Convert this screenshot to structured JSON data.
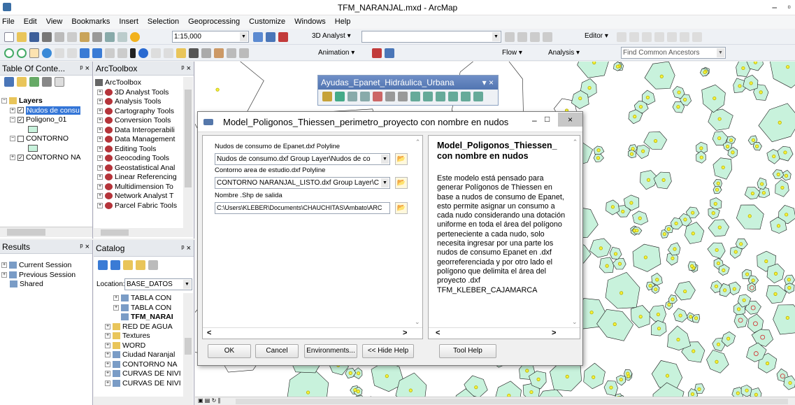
{
  "window": {
    "title": "TFM_NARANJAL.mxd - ArcMap",
    "minimize": "–",
    "restore": "▫"
  },
  "menu": [
    "File",
    "Edit",
    "View",
    "Bookmarks",
    "Insert",
    "Selection",
    "Geoprocessing",
    "Customize",
    "Windows",
    "Help"
  ],
  "toolbar": {
    "scale": "1:15,000",
    "analyst3d": "3D Analyst",
    "editor": "Editor",
    "animation": "Animation",
    "flow": "Flow",
    "analysis": "Analysis",
    "find_ancestors": "Find Common Ancestors"
  },
  "toc": {
    "title": "Table Of Conte...",
    "layers_label": "Layers",
    "items": [
      {
        "label": "Nudos de consu",
        "checked": true
      },
      {
        "label": "Poligono_01",
        "checked": true
      },
      {
        "label": "CONTORNO",
        "checked": false
      },
      {
        "label": "CONTORNO NA",
        "checked": true
      }
    ]
  },
  "arctoolbox": {
    "title": "ArcToolbox",
    "root": "ArcToolbox",
    "items": [
      "3D Analyst Tools",
      "Analysis Tools",
      "Cartography Tools",
      "Conversion Tools",
      "Data Interoperabili",
      "Data Management",
      "Editing Tools",
      "Geocoding Tools",
      "Geostatistical Anal",
      "Linear Referencing",
      "Multidimension To",
      "Network Analyst T",
      "Parcel Fabric Tools"
    ]
  },
  "results": {
    "title": "Results",
    "items": [
      "Current Session",
      "Previous Session",
      "Shared"
    ]
  },
  "catalog": {
    "title": "Catalog",
    "location_label": "Location:",
    "location_value": "BASE_DATOS",
    "items": [
      {
        "label": "TABLA CON",
        "kind": "table",
        "indent": 2
      },
      {
        "label": "TABLA CON",
        "kind": "table",
        "indent": 2
      },
      {
        "label": "TFM_NARAI",
        "kind": "mxd",
        "indent": 2
      },
      {
        "label": "RED DE AGUA",
        "kind": "folder",
        "indent": 1
      },
      {
        "label": "Textures",
        "kind": "folder",
        "indent": 1
      },
      {
        "label": "WORD",
        "kind": "folder",
        "indent": 1
      },
      {
        "label": "Ciudad Naranjal",
        "kind": "db",
        "indent": 1
      },
      {
        "label": "CONTORNO NA",
        "kind": "db",
        "indent": 1
      },
      {
        "label": "CURVAS DE NIVI",
        "kind": "db",
        "indent": 1
      },
      {
        "label": "CURVAS DE NIVI",
        "kind": "db",
        "indent": 1
      }
    ]
  },
  "ayudas": {
    "title": "Ayudas_Epanet_Hidráulica_Urbana"
  },
  "dialog": {
    "title": "Model_Poligonos_Thiessen_perimetro_proyecto con nombre en nudos",
    "fields": [
      {
        "label": "Nudos de consumo de Epanet.dxf Polyline",
        "value": "Nudos de consumo.dxf Group Layer\\Nudos de co"
      },
      {
        "label": "Contorno area de estudio.dxf Polyline",
        "value": "CONTORNO NARANJAL_LISTO.dxf Group Layer\\C"
      },
      {
        "label": "Nombre .Shp de salida",
        "value": "C:\\Users\\KLEBER\\Documents\\CHAUCHITAS\\Ambato\\ARC"
      }
    ],
    "help_title": "Model_Poligonos_Thiessen_ con nombre en nudos",
    "help_text": "Este modelo está pensado para generar Polígonos de Thiessen en base a nudos de consumo de Epanet, esto permite asignar un consumo a cada nudo considerando una dotación uniforme en toda el área del polígono perteneciente a cada nudo, solo necesita ingresar por una parte los nudos de consumo Epanet en .dxf georreferenciada y por otro lado el polígono que delimita el área del proyecto .dxf TFM_KLEBER_CAJAMARCA",
    "buttons": {
      "ok": "OK",
      "cancel": "Cancel",
      "environments": "Environments...",
      "hide_help": "<< Hide Help",
      "tool_help": "Tool Help"
    }
  },
  "colors": {
    "map_fill": "#c8f2dc",
    "map_line": "#1a1a1a",
    "node_yellow": "#f5f23a",
    "node_red": "#d02828",
    "dialog_bg": "#f0f0f0"
  }
}
